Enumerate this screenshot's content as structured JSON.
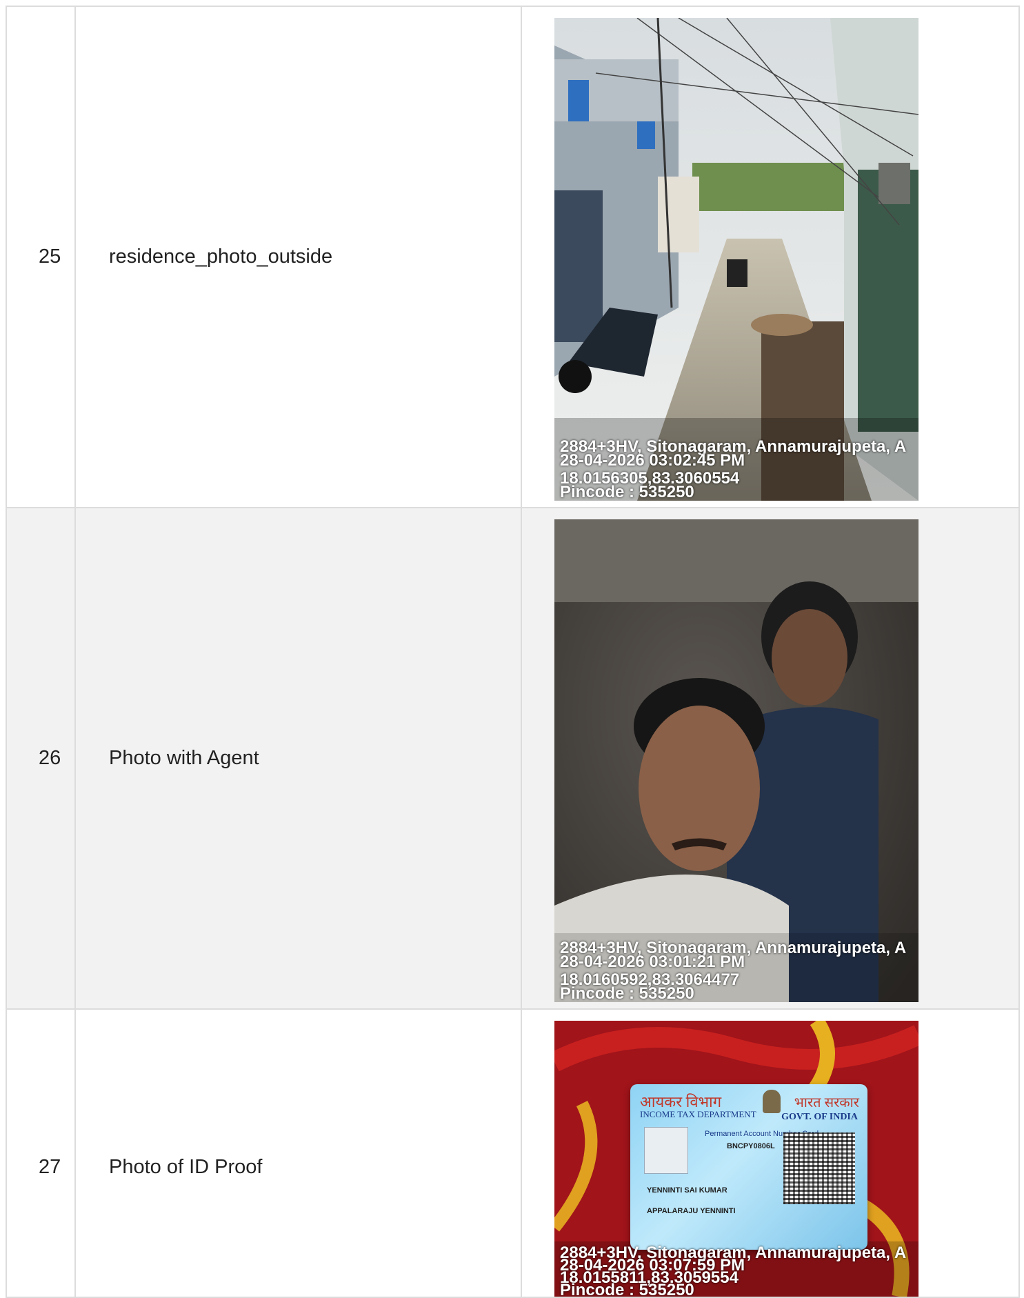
{
  "rows": [
    {
      "number": "25",
      "label": "residence_photo_outside",
      "photo": {
        "icon": "residence-street-photo",
        "stamp": {
          "address": "2884+3HV, Sitonagaram, Annamurajupeta, A",
          "datetime": "28-04-2026 03:02:45 PM",
          "coords": "18.0156305,83.3060554",
          "pincode": "Pincode : 535250"
        }
      }
    },
    {
      "number": "26",
      "label": "Photo with Agent",
      "photo": {
        "icon": "agent-selfie-photo",
        "stamp": {
          "address": "2884+3HV, Sitonagaram, Annamurajupeta, A",
          "datetime": "28-04-2026 03:01:21 PM",
          "coords": "18.0160592,83.3064477",
          "pincode": "Pincode : 535250"
        }
      }
    },
    {
      "number": "27",
      "label": "Photo of ID Proof",
      "photo": {
        "icon": "pan-card-photo",
        "card": {
          "hindi_left": "आयकर विभाग",
          "hindi_right": "भारत सरकार",
          "dept": "INCOME TAX DEPARTMENT",
          "govt": "GOVT. OF INDIA",
          "title": "Permanent Account Number Card",
          "number": "BNCPY0806L",
          "name": "YENNINTI SAI KUMAR",
          "father": "APPALARAJU YENNINTI"
        },
        "stamp": {
          "address": "2884+3HV, Sitonagaram, Annamurajupeta, A",
          "datetime": "28-04-2026 03:07:59 PM",
          "coords": "18.0155811,83.3059554",
          "pincode": "Pincode : 535250"
        }
      }
    }
  ],
  "colors": {
    "border": "#dcdcdc",
    "shaded_row": "#f2f2f2"
  }
}
